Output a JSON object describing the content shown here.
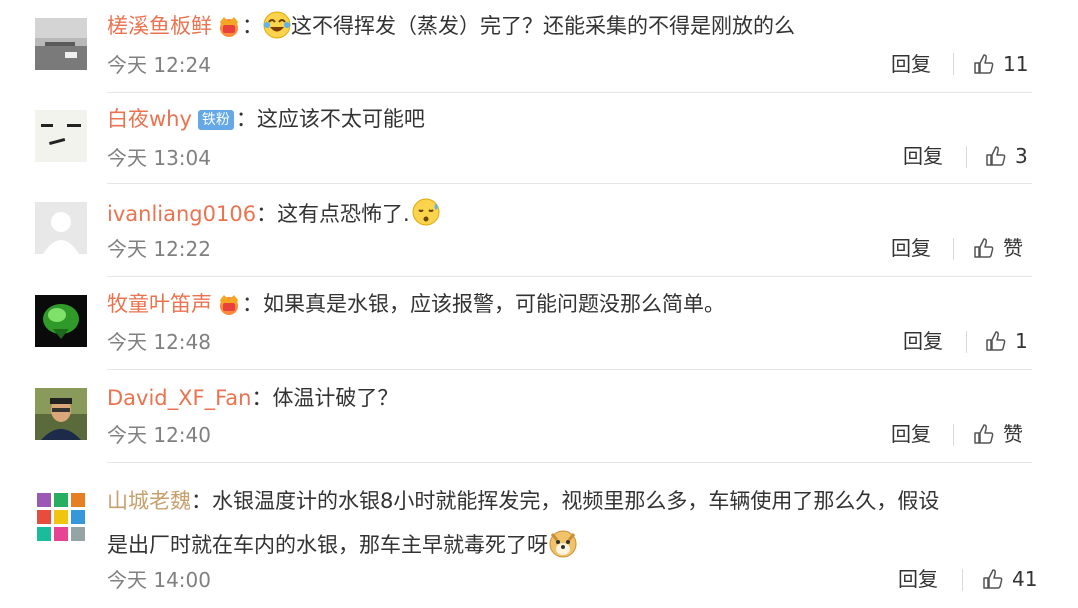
{
  "comments": [
    {
      "username": "槎溪鱼板鲜",
      "colon": "：",
      "text": "这不得挥发（蒸发）完了？还能采集的不得是刚放的么",
      "time": "今天 12:24",
      "reply": "回复",
      "like": "11",
      "badge": "crown-icon",
      "emoji": "laughing-crying-emoji"
    },
    {
      "username": "白夜why",
      "colon": "：",
      "text": "这应该不太可能吧",
      "time": "今天 13:04",
      "reply": "回复",
      "like": "3",
      "badge_text": "铁粉"
    },
    {
      "username": "ivanliang0106",
      "colon": "：",
      "text": "这有点恐怖了.",
      "time": "今天 12:22",
      "reply": "回复",
      "like": "赞",
      "emoji": "sweat-emoji"
    },
    {
      "username": "牧童叶笛声",
      "colon": "：",
      "text": "如果真是水银，应该报警，可能问题没那么简单。",
      "time": "今天 12:48",
      "reply": "回复",
      "like": "1",
      "badge": "crown-icon"
    },
    {
      "username": "David_XF_Fan",
      "colon": "：",
      "text": "体温计破了？",
      "time": "今天 12:40",
      "reply": "回复",
      "like": "赞"
    },
    {
      "username": "山城老魏",
      "colon": "：",
      "text_line1": "水银温度计的水银8小时就能挥发完，视频里那么多，车辆使用了那么久，假设",
      "text_line2": "是出厂时就在车内的水银，那车主早就毒死了呀",
      "time": "今天 14:00",
      "reply": "回复",
      "like": "41",
      "emoji": "doge-emoji"
    }
  ],
  "colors": {
    "username": "#eb7350",
    "time": "#808080",
    "text": "#333333",
    "badge_blue": "#64a8e8"
  }
}
